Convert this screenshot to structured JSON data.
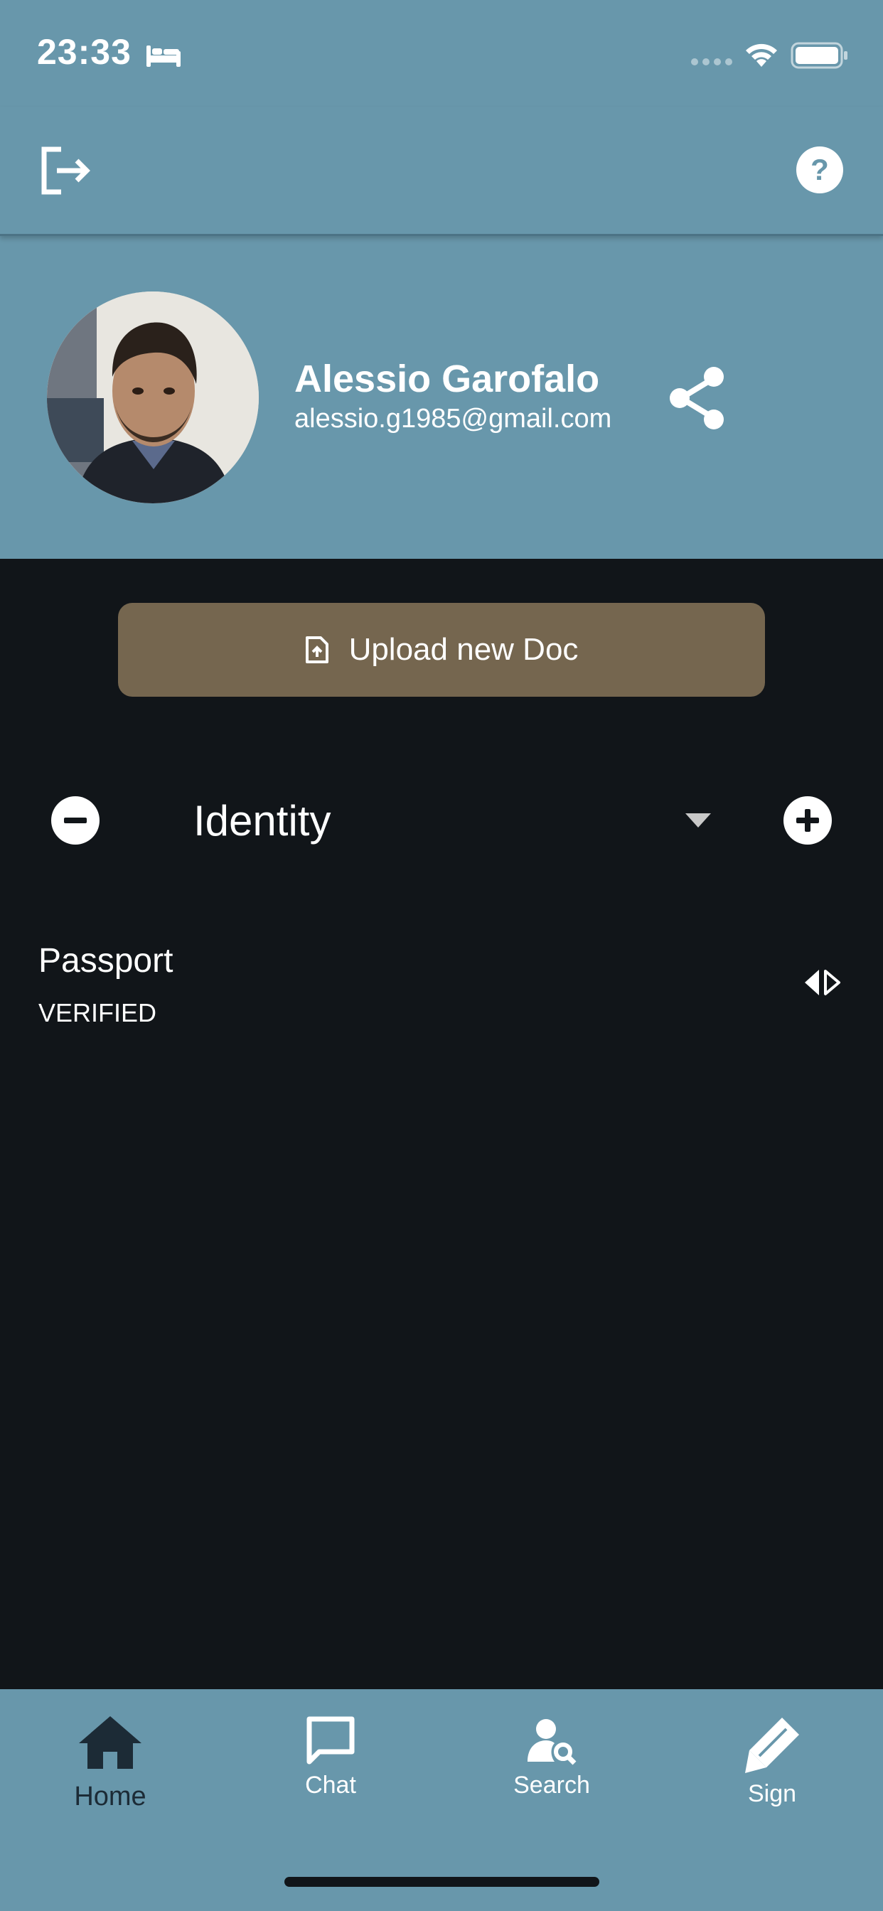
{
  "status_bar": {
    "time": "23:33",
    "icons": [
      "bed-icon",
      "signal-dots-icon",
      "wifi-icon",
      "battery-icon"
    ]
  },
  "app_bar": {
    "left_icon": "logout-icon",
    "right_icon": "help-icon"
  },
  "profile": {
    "name": "Alessio Garofalo",
    "email": "alessio.g1985@gmail.com",
    "share_icon": "share-icon"
  },
  "upload": {
    "label": "Upload new Doc",
    "icon": "file-upload-icon"
  },
  "category": {
    "selected": "Identity",
    "remove_icon": "minus-circle-icon",
    "add_icon": "plus-circle-icon",
    "dropdown_icon": "caret-down-icon"
  },
  "documents": [
    {
      "title": "Passport",
      "status": "VERIFIED",
      "action_icon": "expand-arrows-icon"
    }
  ],
  "bottom_nav": {
    "items": [
      {
        "label": "Home",
        "icon": "home-icon",
        "active": true
      },
      {
        "label": "Chat",
        "icon": "chat-icon",
        "active": false
      },
      {
        "label": "Search",
        "icon": "user-search-icon",
        "active": false
      },
      {
        "label": "Sign",
        "icon": "pen-icon",
        "active": false
      }
    ]
  },
  "colors": {
    "header_bg": "#6897ab",
    "body_bg": "#111519",
    "upload_button": "#75664f",
    "active_nav": "#1c2b36",
    "text": "#ffffff"
  }
}
